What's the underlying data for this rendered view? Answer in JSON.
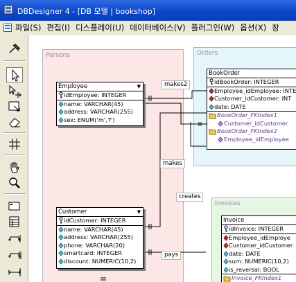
{
  "window": {
    "title": "DBDesigner 4 - [DB 모델 | bookshop]"
  },
  "menu": [
    "파일(S)",
    "편집(I)",
    "디스플레이(U)",
    "데이터베이스(V)",
    "플러그인(W)",
    "옵션(X)",
    "창"
  ],
  "toolbar_icons": [
    "pin-icon",
    "pointer-icon",
    "move-icon",
    "resize-icon",
    "eraser-icon",
    "grid-icon",
    "hand-icon",
    "zoom-icon",
    "region-icon",
    "table-icon",
    "relation-1n-icon",
    "relation-11-icon",
    "relation-nm-icon"
  ],
  "regions": {
    "persons": "Persons",
    "orders": "Orders",
    "invoices": "Invoices"
  },
  "tables": {
    "employee": {
      "name": "Employee",
      "pk": "idEmployee: INTEGER",
      "cols": [
        "name: VARCHAR(45)",
        "address: VARCHAR(255)",
        "sex: ENUM('m','f')"
      ]
    },
    "customer": {
      "name": "Customer",
      "pk": "idCustomer: INTEGER",
      "cols": [
        "name: VARCHAR(45)",
        "address: VARCHAR(255)",
        "phone: VARCHAR(20)",
        "smartcard: INTEGER",
        "discount: NUMERIC(10,2)"
      ]
    },
    "bookorder": {
      "name": "BookOrder",
      "pk": "idBookOrder: INTEGER",
      "fks": [
        "Employee_idEmployee: INTE",
        "Customer_idCustomer: INT"
      ],
      "cols": [
        "date: DATE"
      ],
      "indexes": [
        {
          "name": "BookOrder_FKIndex1",
          "col": "Customer_idCustomer"
        },
        {
          "name": "BookOrder_FKIndex2",
          "col": "Employee_idEmployee"
        }
      ]
    },
    "invoice": {
      "name": "Invoice",
      "pk": "idInvoice: INTEGER",
      "fks": [
        "Employee_idEmploye",
        "Customer_idCustomer"
      ],
      "cols": [
        "date: DATE",
        "sum: NUMERIC(10,2)",
        "is_reversal: BOOL"
      ],
      "partial_index": "Invoice_FKIndex1"
    }
  },
  "relations": {
    "makes2": "makes2",
    "makes": "makes",
    "creates": "creates",
    "pays": "pays"
  },
  "colors": {
    "persons_bg": "#fde6e6",
    "orders_bg": "#e4f6fa",
    "invoices_bg": "#e5f6e5",
    "title_blue": "#0c47c9"
  }
}
